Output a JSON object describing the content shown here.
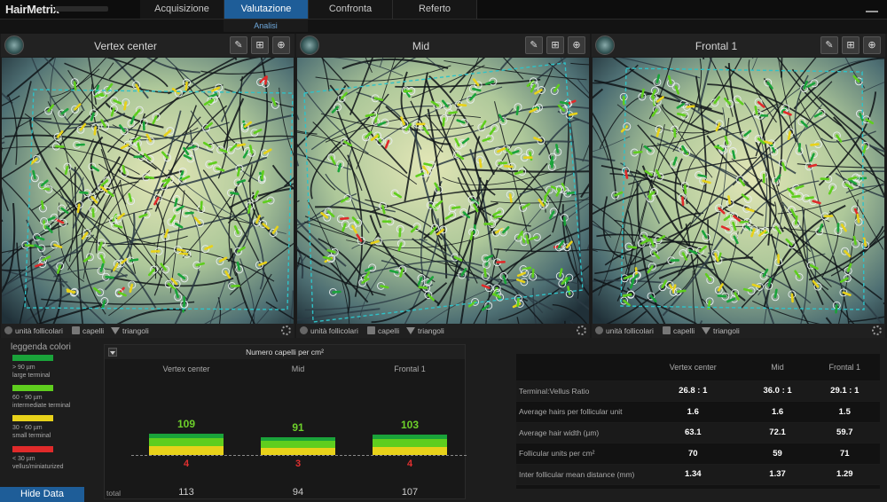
{
  "app": {
    "title": "HairMetrix"
  },
  "tabs": [
    "Acquisizione",
    "Valutazione",
    "Confronta",
    "Referto"
  ],
  "active_tab": "Valutazione",
  "subtab": "Analisi",
  "panels": [
    {
      "title": "Vertex center"
    },
    {
      "title": "Mid"
    },
    {
      "title": "Frontal 1"
    }
  ],
  "panel_footer": {
    "units": "unità follicolari",
    "hairs": "capelli",
    "triangles": "triangoli"
  },
  "legend": {
    "title": "leggenda colori",
    "items": [
      {
        "range": "> 90 µm",
        "label": "large terminal",
        "color": "#1aa33a"
      },
      {
        "range": "60 - 90 µm",
        "label": "intermediate terminal",
        "color": "#5fce1e"
      },
      {
        "range": "30 - 60 µm",
        "label": "small terminal",
        "color": "#e8d21a"
      },
      {
        "range": "< 30 µm",
        "label": "vellus/miniaturized",
        "color": "#e02a2a"
      }
    ]
  },
  "hide_button": "Hide Data",
  "chart_data": {
    "type": "bar",
    "title": "Numero capelli per cm²",
    "categories": [
      "Vertex center",
      "Mid",
      "Frontal 1"
    ],
    "terminal": [
      109,
      91,
      103
    ],
    "vellus": [
      4,
      3,
      4
    ],
    "total": [
      113,
      94,
      107
    ],
    "total_label": "total",
    "colors": {
      "large": "#1aa33a",
      "intermediate": "#5fce1e",
      "small": "#e8d21a",
      "vellus": "#e02a2a"
    }
  },
  "stats": {
    "columns": [
      "Vertex center",
      "Mid",
      "Frontal 1"
    ],
    "rows": [
      {
        "label": "Terminal:Vellus Ratio",
        "values": [
          "26.8 : 1",
          "36.0 : 1",
          "29.1 : 1"
        ]
      },
      {
        "label": "Average hairs per follicular unit",
        "values": [
          "1.6",
          "1.6",
          "1.5"
        ]
      },
      {
        "label": "Average hair width (µm)",
        "values": [
          "63.1",
          "72.1",
          "59.7"
        ]
      },
      {
        "label": "Follicular units per cm²",
        "values": [
          "70",
          "59",
          "71"
        ]
      },
      {
        "label": "Inter follicular mean distance (mm)",
        "values": [
          "1.34",
          "1.37",
          "1.29"
        ]
      }
    ]
  }
}
